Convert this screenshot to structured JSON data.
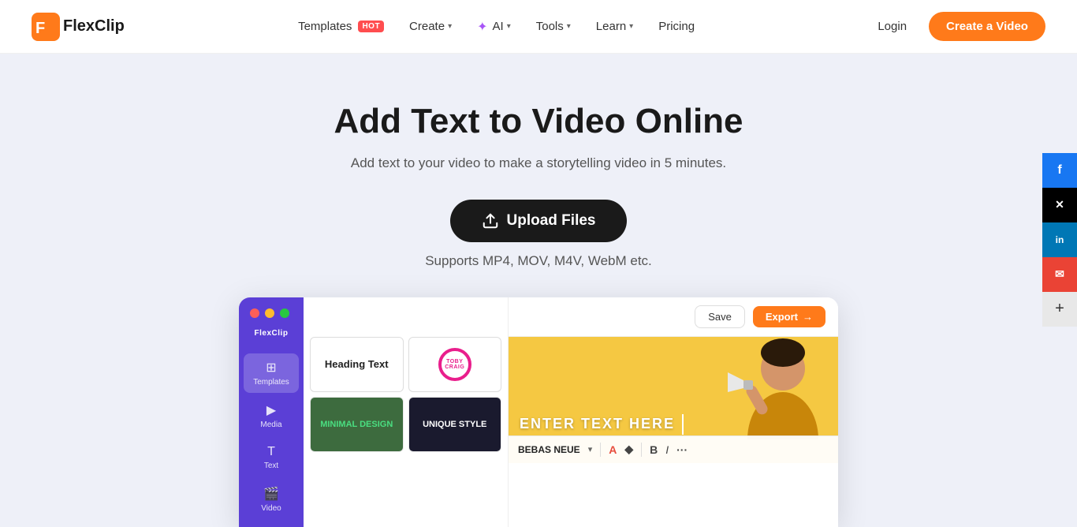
{
  "nav": {
    "logo_text": "FlexClip",
    "links": [
      {
        "label": "Templates",
        "hot": true,
        "chevron": false
      },
      {
        "label": "Create",
        "hot": false,
        "chevron": true
      },
      {
        "label": "AI",
        "hot": false,
        "chevron": true,
        "ai": true
      },
      {
        "label": "Tools",
        "hot": false,
        "chevron": true
      },
      {
        "label": "Learn",
        "hot": false,
        "chevron": true
      },
      {
        "label": "Pricing",
        "hot": false,
        "chevron": false
      }
    ],
    "login": "Login",
    "create": "Create a Video"
  },
  "hero": {
    "title": "Add Text to Video Online",
    "subtitle": "Add text to your video to make a storytelling video in 5 minutes.",
    "upload_label": "Upload Files",
    "supports_text": "Supports MP4, MOV, M4V, WebM etc."
  },
  "preview": {
    "save_label": "Save",
    "export_label": "Export",
    "font_name": "BEBAS NEUE",
    "enter_text": "ENTER TEXT HERE",
    "templates": [
      {
        "id": "heading",
        "label": "Heading Text",
        "style": "heading"
      },
      {
        "id": "toby",
        "label": "TOBY CRAIG",
        "style": "toby"
      },
      {
        "id": "minimal",
        "label": "MINIMAL DESIGN",
        "style": "minimal"
      },
      {
        "id": "unique",
        "label": "UNIQUE STYLE",
        "style": "unique"
      }
    ]
  },
  "sidebar": {
    "logo": "FlexClip",
    "items": [
      {
        "label": "Templates",
        "icon": "⊞"
      },
      {
        "label": "Media",
        "icon": "▶"
      },
      {
        "label": "Text",
        "icon": "T"
      },
      {
        "label": "Video",
        "icon": "🎬"
      }
    ]
  },
  "social": [
    {
      "label": "f",
      "name": "facebook"
    },
    {
      "label": "𝕏",
      "name": "twitter"
    },
    {
      "label": "in",
      "name": "linkedin"
    },
    {
      "label": "✉",
      "name": "email"
    },
    {
      "label": "+",
      "name": "more"
    }
  ],
  "colors": {
    "orange": "#ff7a1a",
    "purple": "#5b3fd6",
    "dark": "#1a1a1a"
  }
}
